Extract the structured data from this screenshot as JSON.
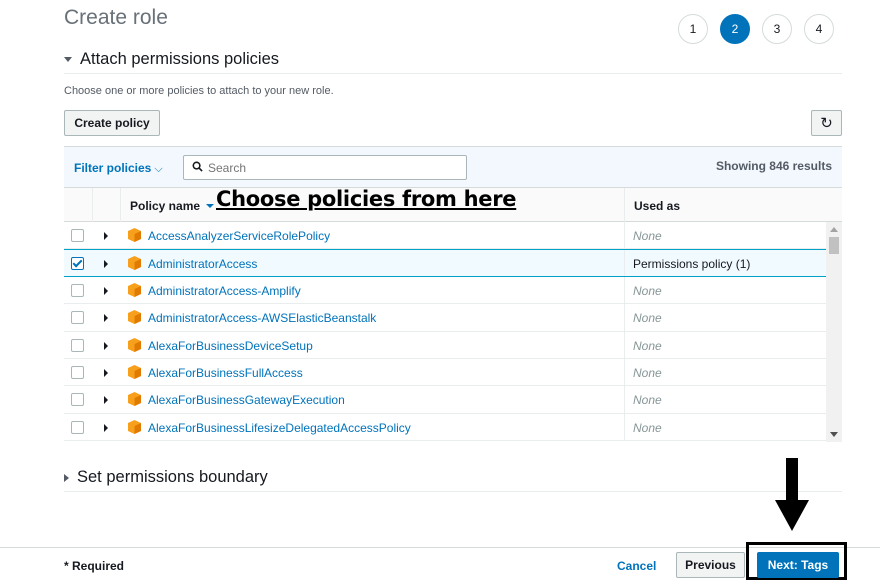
{
  "header": {
    "title": "Create role",
    "steps": [
      {
        "label": "1",
        "active": false
      },
      {
        "label": "2",
        "active": true
      },
      {
        "label": "3",
        "active": false
      },
      {
        "label": "4",
        "active": false
      }
    ]
  },
  "attach_section": {
    "title": "Attach permissions policies",
    "description": "Choose one or more policies to attach to your new role.",
    "create_policy_label": "Create policy",
    "refresh_icon": "refresh-icon"
  },
  "filter": {
    "label": "Filter policies",
    "search_placeholder": "Search",
    "search_value": "",
    "results_text": "Showing 846 results"
  },
  "table": {
    "col_policy_name": "Policy name",
    "col_used_as": "Used as",
    "annotation": "Choose policies from here",
    "rows": [
      {
        "name": "AccessAnalyzerServiceRolePolicy",
        "used_as": "None",
        "checked": false
      },
      {
        "name": "AdministratorAccess",
        "used_as": "Permissions policy (1)",
        "checked": true
      },
      {
        "name": "AdministratorAccess-Amplify",
        "used_as": "None",
        "checked": false
      },
      {
        "name": "AdministratorAccess-AWSElasticBeanstalk",
        "used_as": "None",
        "checked": false
      },
      {
        "name": "AlexaForBusinessDeviceSetup",
        "used_as": "None",
        "checked": false
      },
      {
        "name": "AlexaForBusinessFullAccess",
        "used_as": "None",
        "checked": false
      },
      {
        "name": "AlexaForBusinessGatewayExecution",
        "used_as": "None",
        "checked": false
      },
      {
        "name": "AlexaForBusinessLifesizeDelegatedAccessPolicy",
        "used_as": "None",
        "checked": false
      }
    ]
  },
  "boundary_section": {
    "title": "Set permissions boundary"
  },
  "footer": {
    "required_label": "* Required",
    "cancel_label": "Cancel",
    "previous_label": "Previous",
    "next_label": "Next: Tags"
  },
  "colors": {
    "accent": "#0073bb",
    "policy_icon": "#f7a01e",
    "selected_row": "#f1faff"
  }
}
